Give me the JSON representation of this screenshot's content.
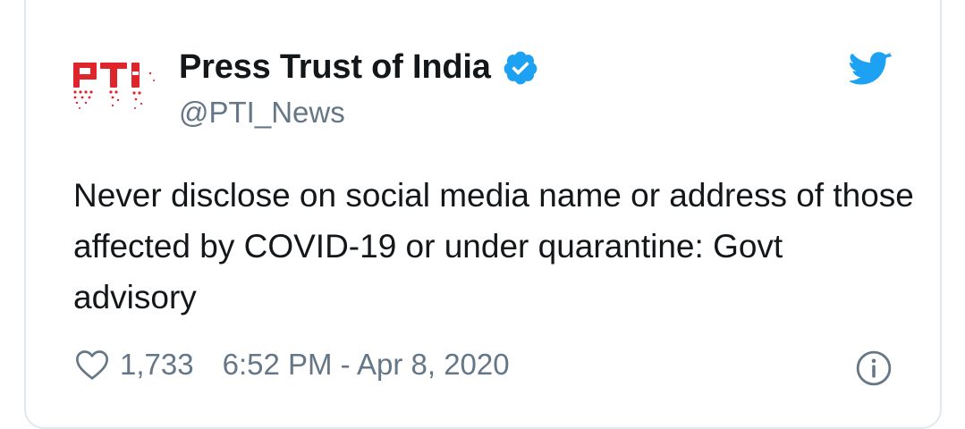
{
  "tweet": {
    "display_name": "Press Trust of India",
    "handle": "@PTI_News",
    "text": "Never disclose on social media name or address of those affected by COVID-19 or under quarantine: Govt advisory",
    "like_count": "1,733",
    "timestamp": "6:52 PM - Apr 8, 2020",
    "avatar_logo_text": "PTI"
  },
  "icons": {
    "verified": "verified-badge-icon",
    "twitter": "twitter-bird-icon",
    "like": "heart-icon",
    "info": "info-icon"
  },
  "colors": {
    "twitter_blue": "#1da1f2",
    "text_primary": "#14171a",
    "text_secondary": "#657786",
    "pti_red": "#e0242b",
    "border": "#e1e8ed"
  }
}
